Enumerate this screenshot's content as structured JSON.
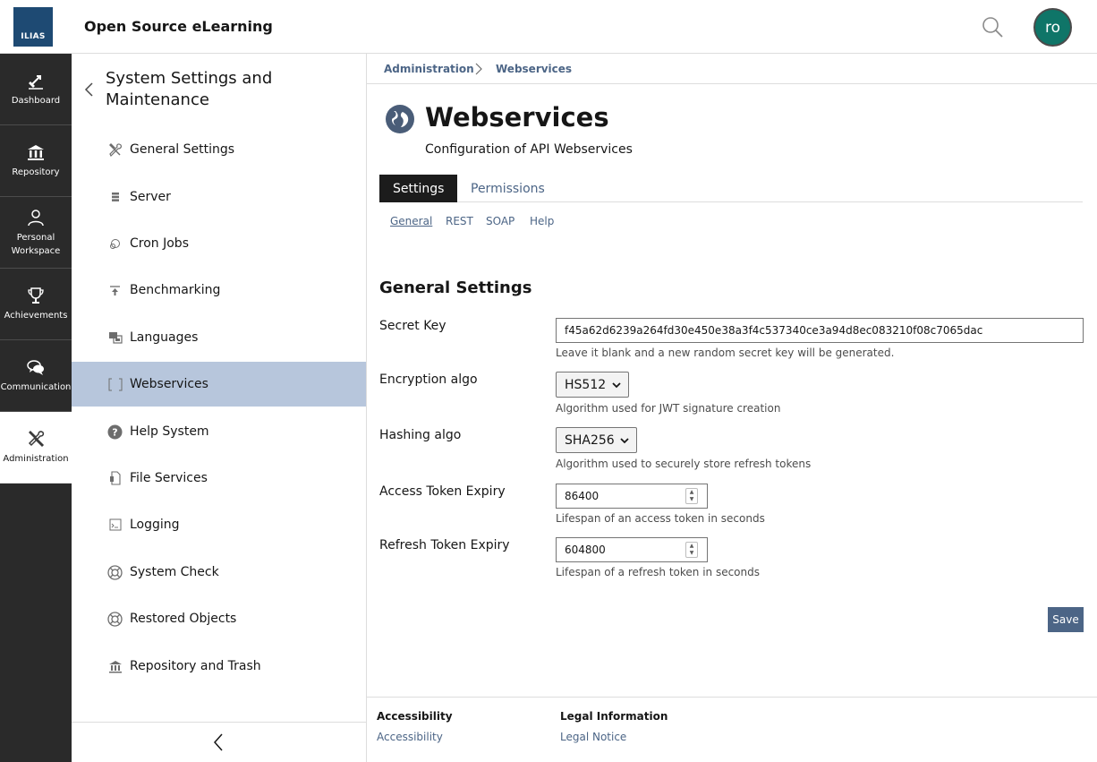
{
  "header": {
    "logo_text": "ILIAS",
    "site_title": "Open Source eLearning",
    "avatar_initials": "ro"
  },
  "mainbar": {
    "items": [
      {
        "label": "Dashboard",
        "icon": "dashboard-icon"
      },
      {
        "label": "Repository",
        "icon": "repository-icon"
      },
      {
        "label_line1": "Personal",
        "label_line2": "Workspace",
        "icon": "person-icon"
      },
      {
        "label": "Achievements",
        "icon": "trophy-icon"
      },
      {
        "label": "Communication",
        "icon": "chat-icon"
      },
      {
        "label": "Administration",
        "icon": "tools-icon",
        "active": true
      }
    ]
  },
  "slate": {
    "title": "System Settings and Maintenance",
    "items": [
      {
        "label": "General Settings"
      },
      {
        "label": "Server"
      },
      {
        "label": "Cron Jobs"
      },
      {
        "label": "Benchmarking"
      },
      {
        "label": "Languages"
      },
      {
        "label": "Webservices",
        "active": true
      },
      {
        "label": "Help System"
      },
      {
        "label": "File Services"
      },
      {
        "label": "Logging"
      },
      {
        "label": "System Check"
      },
      {
        "label": "Restored Objects"
      },
      {
        "label": "Repository and Trash"
      }
    ]
  },
  "breadcrumb": {
    "items": [
      "Administration",
      "Webservices"
    ]
  },
  "page": {
    "title": "Webservices",
    "description": "Configuration of API Webservices"
  },
  "tabs": [
    "Settings",
    "Permissions"
  ],
  "subtabs": [
    "General",
    "REST",
    "SOAP",
    "Help"
  ],
  "form": {
    "section_title": "General Settings",
    "secret_key": {
      "label": "Secret Key",
      "value": "f45a62d6239a264fd30e450e38a3f4c537340ce3a94d8ec083210f08c7065dac",
      "byline": "Leave it blank and a new random secret key will be generated."
    },
    "encryption": {
      "label": "Encryption algo",
      "value": "HS512",
      "byline": "Algorithm used for JWT signature creation"
    },
    "hashing": {
      "label": "Hashing algo",
      "value": "SHA256",
      "byline": "Algorithm used to securely store refresh tokens"
    },
    "access_expiry": {
      "label": "Access Token Expiry",
      "value": "86400",
      "byline": "Lifespan of an access token in seconds"
    },
    "refresh_expiry": {
      "label": "Refresh Token Expiry",
      "value": "604800",
      "byline": "Lifespan of a refresh token in seconds"
    },
    "save_label": "Save"
  },
  "footer": {
    "col1_head": "Accessibility",
    "col1_link": "Accessibility",
    "col2_head": "Legal Information",
    "col2_link": "Legal Notice"
  },
  "colors": {
    "mainbar_bg": "#2a2a2a",
    "accent": "#4c6586",
    "active_slate": "#b7c6dc",
    "avatar": "#0f7568",
    "logo": "#1e4a73"
  }
}
